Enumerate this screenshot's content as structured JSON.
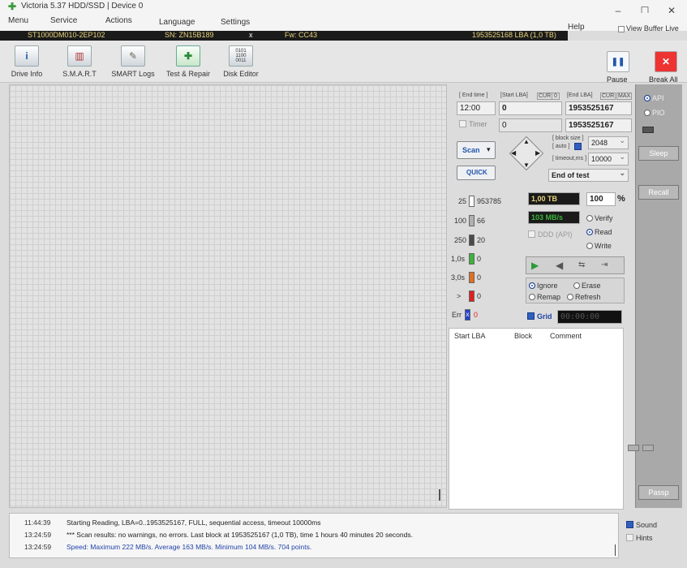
{
  "window": {
    "title": "Victoria 5.37 HDD/SSD | Device 0",
    "controls": [
      "–",
      "☐",
      "✕"
    ]
  },
  "menu": {
    "items": [
      "Menu",
      "Service",
      "Actions",
      "Language",
      "Settings"
    ],
    "help": "Help",
    "view_buffer": "View Buffer Live"
  },
  "drive": {
    "model": "ST1000DM010-2EP102",
    "sn": "SN: ZN15B189",
    "close": "x",
    "fw": "Fw: CC43",
    "lba": "1953525168 LBA (1,0 TB)"
  },
  "toolbar": {
    "drive_info": "Drive Info",
    "smart": "S.M.A.R.T",
    "smart_logs": "SMART Logs",
    "test_repair": "Test & Repair",
    "disk_editor": "Disk Editor",
    "pause": "Pause",
    "break_all": "Break All"
  },
  "scan": {
    "end_time_lbl": "[ End time ]",
    "start_lba_lbl": "[Start LBA]",
    "cur_lbl": "CUR",
    "zero_lbl": "0",
    "end_lba_lbl": "[End LBA]",
    "max_lbl": "MAX",
    "end_time": "12:00",
    "start_lba": "0",
    "end_lba": "1953525167",
    "timer_lbl": "Timer",
    "timer_val": "0",
    "end_lba2": "1953525167",
    "block_size_lbl": "[ block size ]",
    "auto_lbl": "[ auto ]",
    "block_size": "2048",
    "timeout_lbl": "[ timeout,ms ]",
    "timeout": "10000",
    "scan_btn": "Scan",
    "quick_btn": "QUICK",
    "end_of_test": "End of test"
  },
  "blocks": [
    {
      "label": "25",
      "count": "953785",
      "color": "#ffffff"
    },
    {
      "label": "100",
      "count": "66",
      "color": "#b0b0b0"
    },
    {
      "label": "250",
      "count": "20",
      "color": "#4a4a4a"
    },
    {
      "label": "1,0s",
      "count": "0",
      "color": "#3cb43c"
    },
    {
      "label": "3,0s",
      "count": "0",
      "color": "#e07020"
    },
    {
      "label": ">",
      "count": "0",
      "color": "#e02020"
    },
    {
      "label": "Err",
      "count": "0",
      "color": "#2244cc"
    }
  ],
  "stats": {
    "size": "1,00 TB",
    "percent": "100",
    "percent_sign": "%",
    "speed": "103 MB/s",
    "ddd": "DDD (API)",
    "verify": "Verify",
    "read": "Read",
    "write": "Write"
  },
  "modes": {
    "ignore": "Ignore",
    "erase": "Erase",
    "remap": "Remap",
    "refresh": "Refresh",
    "grid": "Grid",
    "clock": "00:00:00"
  },
  "table": {
    "start_lba": "Start LBA",
    "block": "Block",
    "comment": "Comment"
  },
  "side": {
    "api": "API",
    "pio": "PIO",
    "sleep": "Sleep",
    "recall": "Recall",
    "passp": "Passp"
  },
  "log": [
    {
      "time": "11:44:39",
      "text": "Starting Reading, LBA=0..1953525167, FULL, sequential access, timeout 10000ms",
      "color": "normal"
    },
    {
      "time": "13:24:59",
      "text": "*** Scan results: no warnings, no errors. Last block at 1953525167 (1,0 TB), time 1 hours 40 minutes 20 seconds.",
      "color": "normal"
    },
    {
      "time": "13:24:59",
      "text": "Speed: Maximum 222 MB/s. Average 163 MB/s. Minimum 104 MB/s. 704 points.",
      "color": "blue"
    }
  ],
  "options": {
    "sound": "Sound",
    "hints": "Hints"
  }
}
